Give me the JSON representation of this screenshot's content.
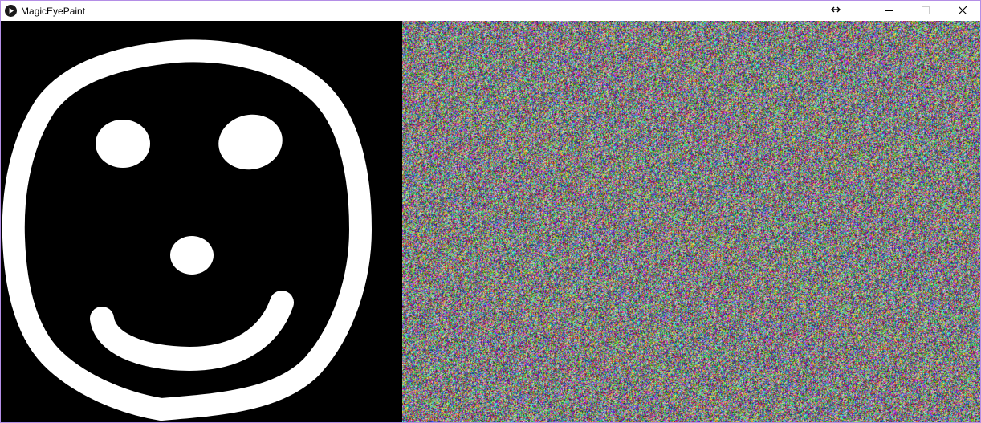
{
  "window": {
    "title": "MagicEyePaint",
    "app_icon": "play-circle-icon",
    "resize_icon": "horizontal-resize-arrows-icon",
    "controls": {
      "minimize_icon": "minimize-icon",
      "maximize_icon": "maximize-icon",
      "close_icon": "close-icon"
    },
    "border_color": "#b48ee6"
  },
  "paint_canvas": {
    "background_color": "#000000",
    "stroke_color": "#ffffff",
    "drawing": "smiley-face"
  },
  "stereogram": {
    "style": "random-dot-colored-noise"
  }
}
